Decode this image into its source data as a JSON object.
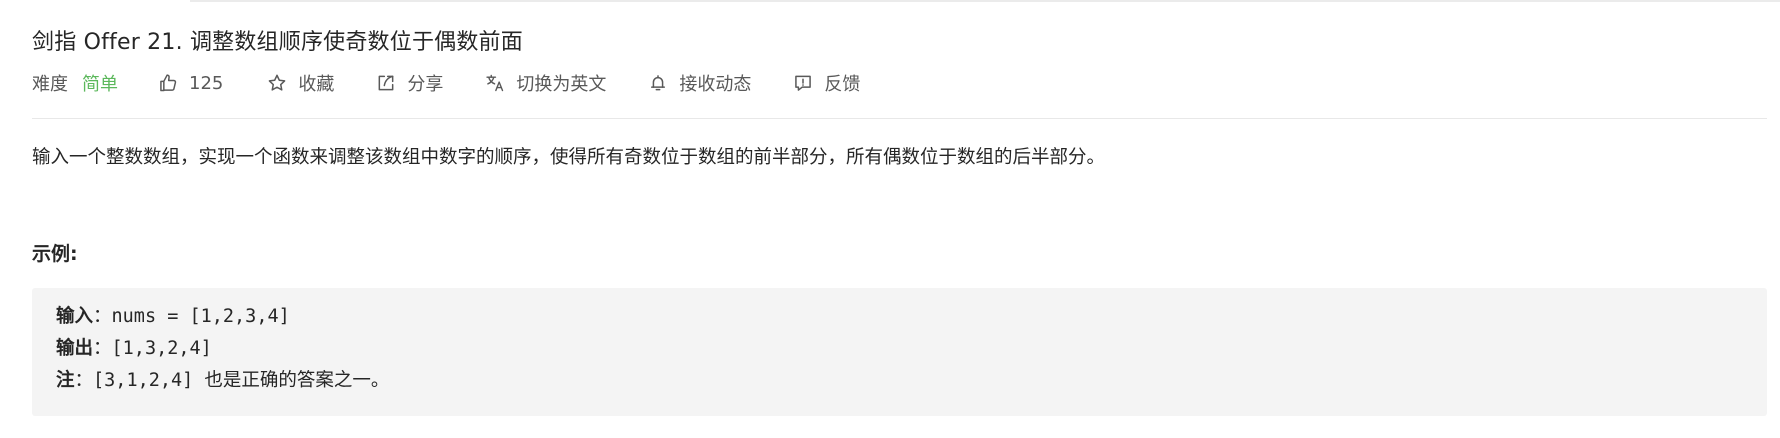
{
  "problem": {
    "title": "剑指 Offer 21. 调整数组顺序使奇数位于偶数前面",
    "difficulty_label": "难度",
    "difficulty_value": "简单",
    "likes": "125",
    "favorite_label": "收藏",
    "share_label": "分享",
    "translate_label": "切换为英文",
    "subscribe_label": "接收动态",
    "feedback_label": "反馈"
  },
  "description": "输入一个整数数组，实现一个函数来调整该数组中数字的顺序，使得所有奇数位于数组的前半部分，所有偶数位于数组的后半部分。",
  "example": {
    "heading": "示例:",
    "input_label": "输入",
    "input_value": "nums = [1,2,3,4]",
    "output_label": "输出",
    "output_value": "[1,3,2,4]",
    "note_label": "注",
    "note_code": "[3,1,2,4]",
    "note_text": "也是正确的答案之一。"
  },
  "colors": {
    "easy": "#5cb85c",
    "text": "#262626",
    "muted": "#595959",
    "code_bg": "#f4f4f4"
  },
  "icons": [
    "thumbs-up-icon",
    "star-icon",
    "share-icon",
    "translate-icon",
    "bell-icon",
    "feedback-icon"
  ]
}
